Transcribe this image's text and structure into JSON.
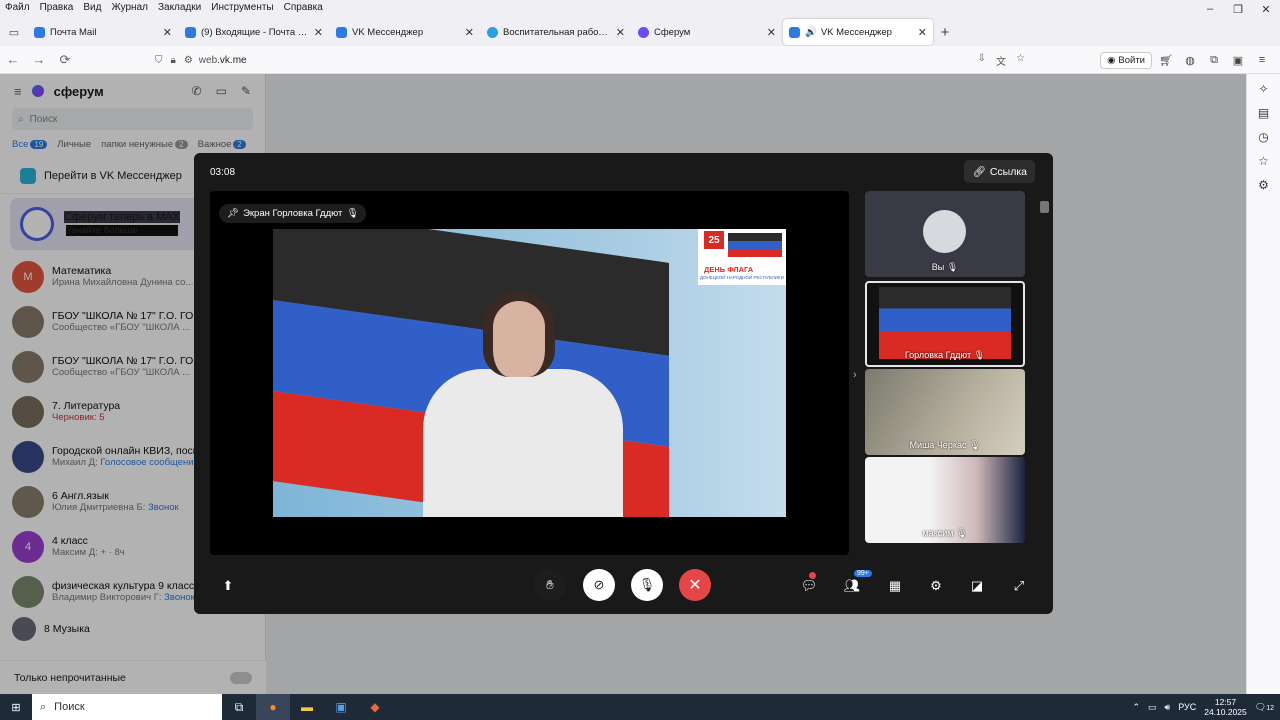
{
  "menu": [
    "Файл",
    "Правка",
    "Вид",
    "Журнал",
    "Закладки",
    "Инструменты",
    "Справка"
  ],
  "window_controls": {
    "minimize": "–",
    "maximize": "❐",
    "close": "✕"
  },
  "tabs": [
    {
      "title": "Почта Mail",
      "color": "#2a7be4",
      "active": false
    },
    {
      "title": "(9) Входящие - Почта Mail",
      "color": "#2a7be4",
      "active": false
    },
    {
      "title": "VK Мессенджер",
      "color": "#2a7be4",
      "active": false
    },
    {
      "title": "Воспитательная работа -школ",
      "color": "#2aa0e4",
      "active": false
    },
    {
      "title": "Сферум",
      "color": "#6b4bff",
      "active": false
    },
    {
      "title": "VK Мессенджер",
      "color": "#2a7be4",
      "active": true
    }
  ],
  "url": {
    "prefix": "web.",
    "host": "vk.me"
  },
  "nav": {
    "back": "←",
    "forward": "→",
    "reload": "⟳",
    "login": "Войти"
  },
  "sidebar": {
    "brand": "сферум",
    "search_placeholder": "Поиск",
    "filters": [
      {
        "label": "Все",
        "count": "19",
        "active": true
      },
      {
        "label": "Личные",
        "count": "",
        "active": false
      },
      {
        "label": "папки ненужные",
        "count": "2",
        "active": false
      },
      {
        "label": "Важное",
        "count": "2",
        "active": false
      }
    ],
    "vk_link": "Перейти в VK Мессенджер",
    "promo": {
      "title": "Сферум теперь в MAX",
      "subtitle": "Узнайте больше"
    },
    "chats": [
      {
        "avatar": "М",
        "color": "#e4573f",
        "name": "Математика",
        "last": "Ирина Михайловна Дунина со...",
        "highlight": ""
      },
      {
        "avatar": "",
        "color": "#8a7a6a",
        "name": "ГБОУ \"ШКОЛА № 17\" Г.О. ГОРЛ",
        "last": "Сообщество «ГБОУ \"ШКОЛА ...",
        "highlight": ""
      },
      {
        "avatar": "",
        "color": "#8a7a6a",
        "name": "ГБОУ \"ШКОЛА № 17\" Г.О. ГОРЛ",
        "last": "Сообщество «ГБОУ \"ШКОЛА ...",
        "highlight": ""
      },
      {
        "avatar": "",
        "color": "#7a6e5e",
        "name": "7. Литература",
        "last": "",
        "draft": "Черновик: 5",
        "highlight": ""
      },
      {
        "avatar": "",
        "color": "#3a4a8a",
        "name": "Городской онлайн КВИЗ, посв",
        "last": "Михаил Д: ",
        "highlight": "Голосовое сообщение"
      },
      {
        "avatar": "",
        "color": "#8a7e6e",
        "name": "6 Англ.язык",
        "last": "Юлия Дмитриевна Б: ",
        "highlight": "Звонок"
      },
      {
        "avatar": "4",
        "color": "#9c3fd1",
        "name": "4 класс",
        "last": "Максим Д: + · 8ч",
        "highlight": ""
      },
      {
        "avatar": "",
        "color": "#7a8a6e",
        "name": "физическая культура 9 класс",
        "last": "Владимир Викторович Г: ",
        "highlight": "Звонок"
      },
      {
        "avatar": "",
        "color": "#6a6a7a",
        "name": "8 Музыка",
        "last": "",
        "highlight": ""
      }
    ],
    "unread_only": "Только непрочитанные"
  },
  "call": {
    "timer": "03:08",
    "link_button": "Ссылка",
    "stage_label": "Экран Горловка Гддют",
    "badge": {
      "day": "25",
      "title": "ДЕНЬ ФЛАГА",
      "subtitle": "ДОНЕЦКОЙ НАРОДНОЙ РЕСПУБЛИКИ"
    },
    "participants": [
      {
        "name": "Вы"
      },
      {
        "name": "Горловка Гддют"
      },
      {
        "name": "Миша Черкас"
      },
      {
        "name": "максим"
      }
    ],
    "participants_count": "99+"
  },
  "taskbar": {
    "search": "Поиск",
    "lang": "РУС",
    "time": "12:57",
    "date": "24.10.2025",
    "notifications": "12"
  }
}
